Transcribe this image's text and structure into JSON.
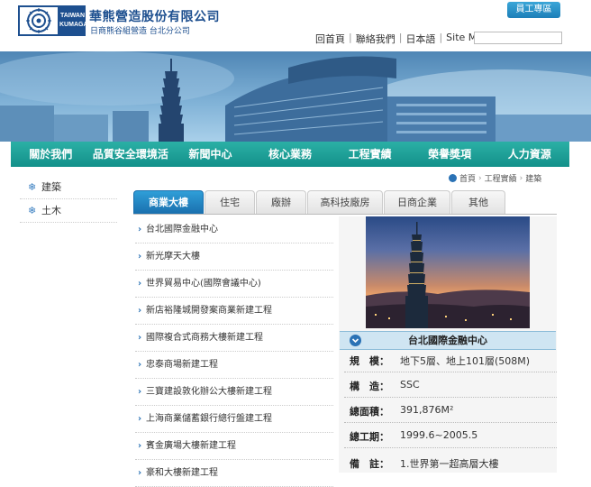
{
  "header": {
    "logo_text_top": "TAIWAN",
    "logo_text_bottom": "KUMAGAI",
    "company_name": "華熊營造股份有限公司",
    "company_sub": "日商熊谷組營造 台北分公司",
    "staff_button": "員工專區",
    "util_links": [
      "回首頁",
      "聯絡我們",
      "日本語",
      "Site Map"
    ],
    "search_placeholder": ""
  },
  "nav": {
    "items": [
      "關於我們",
      "品質安全環境活動",
      "新聞中心",
      "核心業務",
      "工程實績",
      "榮譽獎項",
      "人力資源"
    ]
  },
  "sidebar": {
    "items": [
      "建築",
      "土木"
    ]
  },
  "breadcrumb": [
    "首頁",
    "工程實績",
    "建築"
  ],
  "tabs": [
    "商業大樓",
    "住宅",
    "廠辦",
    "高科技廠房",
    "日商企業",
    "其他"
  ],
  "projects": [
    "台北國際金融中心",
    "新光摩天大樓",
    "世界貿易中心(國際會議中心)",
    "新店裕隆城開發案商業新建工程",
    "國際複合式商務大樓新建工程",
    "忠泰商場新建工程",
    "三寶建設敦化辦公大樓新建工程",
    "上海商業儲蓄銀行總行盤建工程",
    "賓金廣場大樓新建工程",
    "豪和大樓新建工程"
  ],
  "detail": {
    "title": "台北國際金融中心",
    "specs": [
      {
        "label": "規　模：",
        "value": "地下5層、地上101層(508M)"
      },
      {
        "label": "構　造：",
        "value": "SSC"
      },
      {
        "label": "總面積：",
        "value": "391,876M²"
      },
      {
        "label": "總工期：",
        "value": "1999.6~2005.5"
      },
      {
        "label": "備　註：",
        "value": "1.世界第一超高層大樓"
      }
    ]
  },
  "colors": {
    "brand_blue": "#1d4f8f",
    "nav_teal": "#1a9d96",
    "tab_active": "#2383c4"
  }
}
